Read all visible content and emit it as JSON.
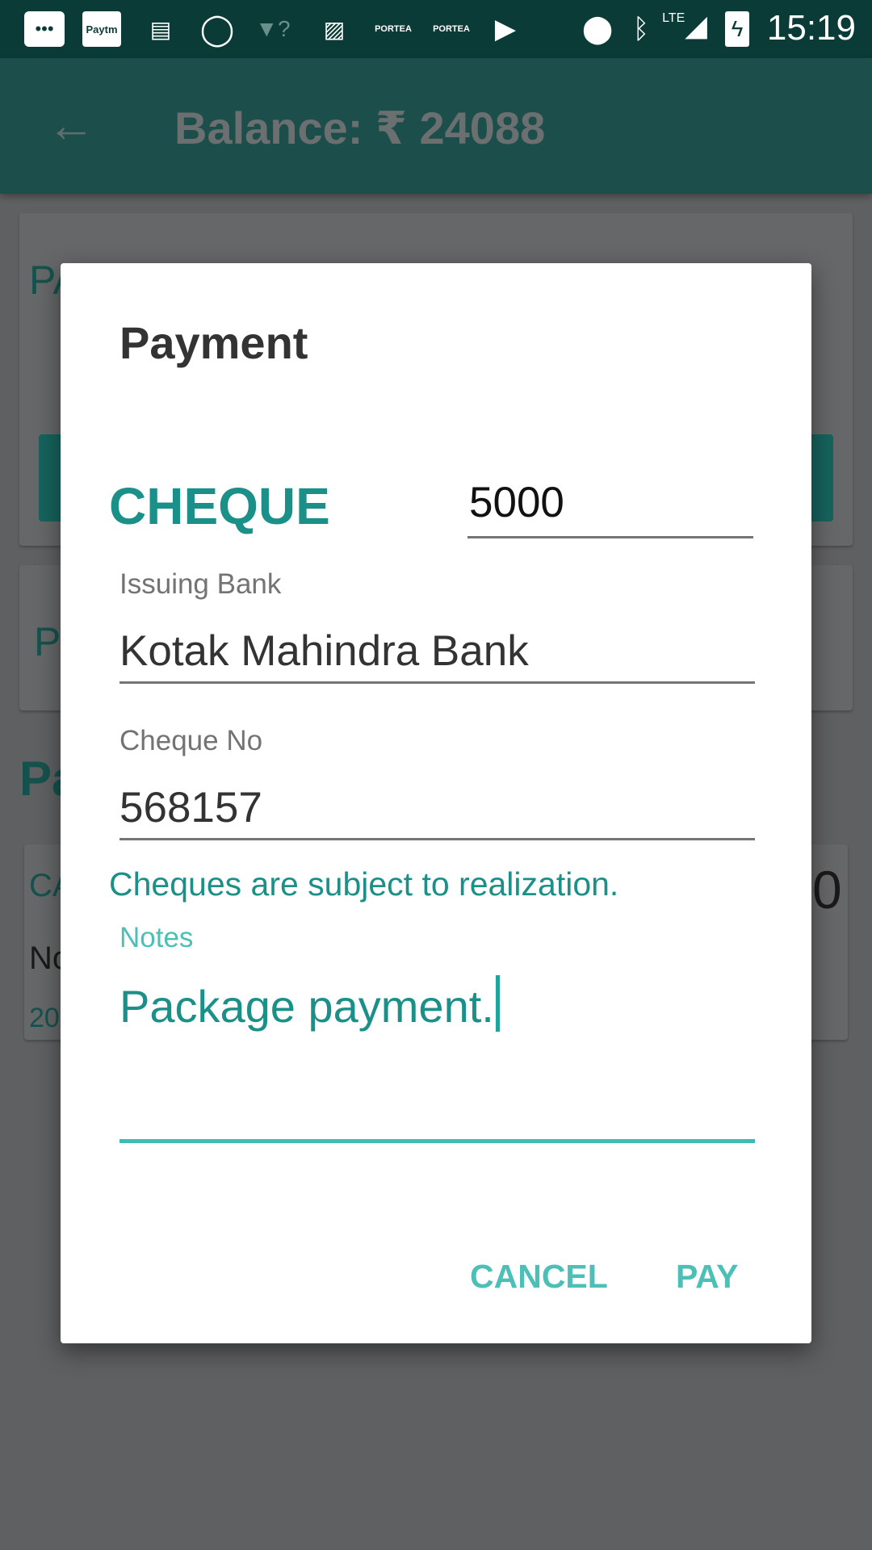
{
  "status_bar": {
    "time": "15:19",
    "network": "LTE",
    "left_icons": [
      "more-icon",
      "paytm-icon",
      "news-icon",
      "whatsapp-icon",
      "wifi-unknown-icon",
      "image-icon",
      "portea-icon",
      "portea-icon",
      "play-store-icon"
    ],
    "paytm_label": "Paytm",
    "portea_label": "PORTEA",
    "right_icons": [
      "location-icon",
      "bluetooth-icon",
      "signal-icon",
      "battery-charging-icon"
    ]
  },
  "app_bar": {
    "back_icon": "arrow-left-icon",
    "title": "Balance: ₹ 24088"
  },
  "background": {
    "fragments": [
      "PA",
      "P",
      "Pa",
      "CA",
      "No",
      "20",
      "0"
    ]
  },
  "dialog": {
    "title": "Payment",
    "mode": "CHEQUE",
    "amount": "5000",
    "issuing_bank": {
      "label": "Issuing Bank",
      "value": "Kotak Mahindra Bank"
    },
    "cheque_no": {
      "label": "Cheque No",
      "value": "568157"
    },
    "helper": "Cheques are subject to realization.",
    "notes": {
      "label": "Notes",
      "value": "Package payment."
    },
    "cancel_label": "CANCEL",
    "pay_label": "PAY"
  },
  "colors": {
    "accent": "#1a9088",
    "accent_light": "#4cc0b7",
    "status_bar": "#0b3b37",
    "app_bar_dimmed": "#1c4f4b",
    "scrim": "#5f6062"
  }
}
